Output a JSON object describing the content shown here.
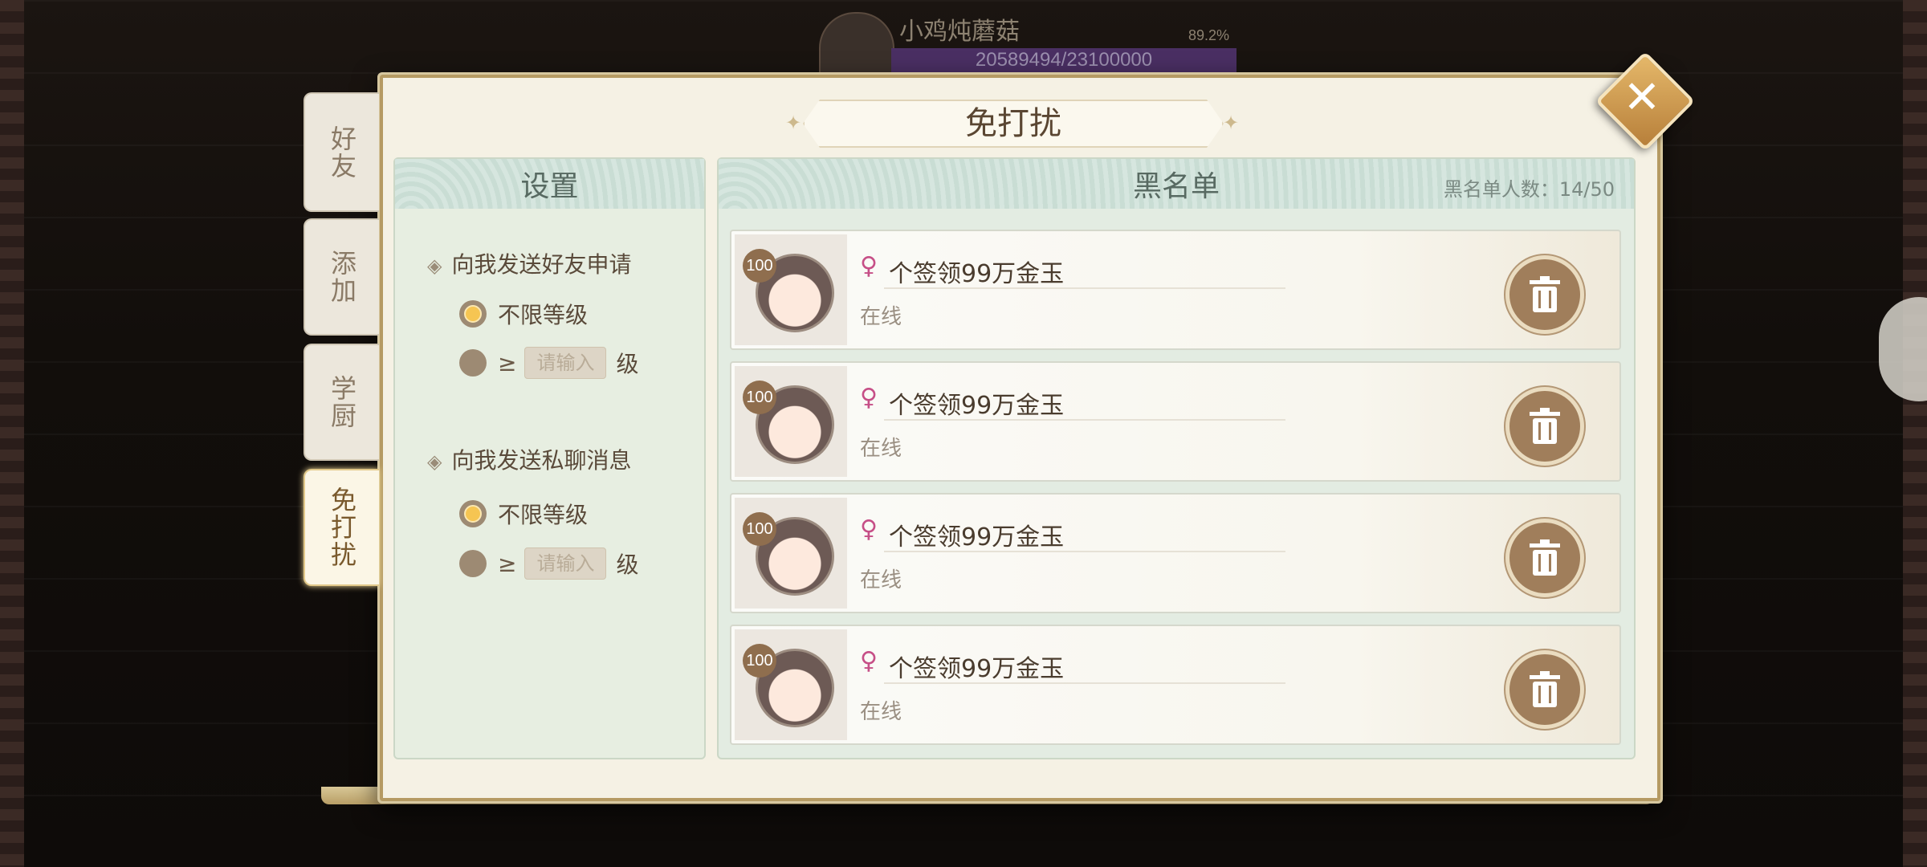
{
  "top": {
    "player_name": "小鸡炖蘑菇",
    "percent": "89.2%",
    "xp": "20589494/23100000"
  },
  "panel": {
    "title": "免打扰"
  },
  "tabs": [
    {
      "label": "好友",
      "active": false
    },
    {
      "label": "添加",
      "active": false
    },
    {
      "label": "学厨",
      "active": false
    },
    {
      "label": "免打扰",
      "active": true
    }
  ],
  "settings": {
    "heading": "设置",
    "groups": [
      {
        "title": "向我发送好友申请",
        "opt_unlimited": "不限等级",
        "opt_ge": "≥",
        "input_placeholder": "请输入",
        "unit": "级",
        "selected": "unlimited"
      },
      {
        "title": "向我发送私聊消息",
        "opt_unlimited": "不限等级",
        "opt_ge": "≥",
        "input_placeholder": "请输入",
        "unit": "级",
        "selected": "unlimited"
      }
    ]
  },
  "blacklist": {
    "heading": "黑名单",
    "count_label": "黑名单人数：14/50",
    "entries": [
      {
        "level": "100",
        "gender_symbol": "♀",
        "name": "个签领99万金玉",
        "status": "在线"
      },
      {
        "level": "100",
        "gender_symbol": "♀",
        "name": "个签领99万金玉",
        "status": "在线"
      },
      {
        "level": "100",
        "gender_symbol": "♀",
        "name": "个签领99万金玉",
        "status": "在线"
      },
      {
        "level": "100",
        "gender_symbol": "♀",
        "name": "个签领99万金玉",
        "status": "在线"
      }
    ]
  },
  "colors": {
    "radio_on": "#f6c552",
    "female": "#c64f87",
    "trash": "#a07e5b"
  }
}
